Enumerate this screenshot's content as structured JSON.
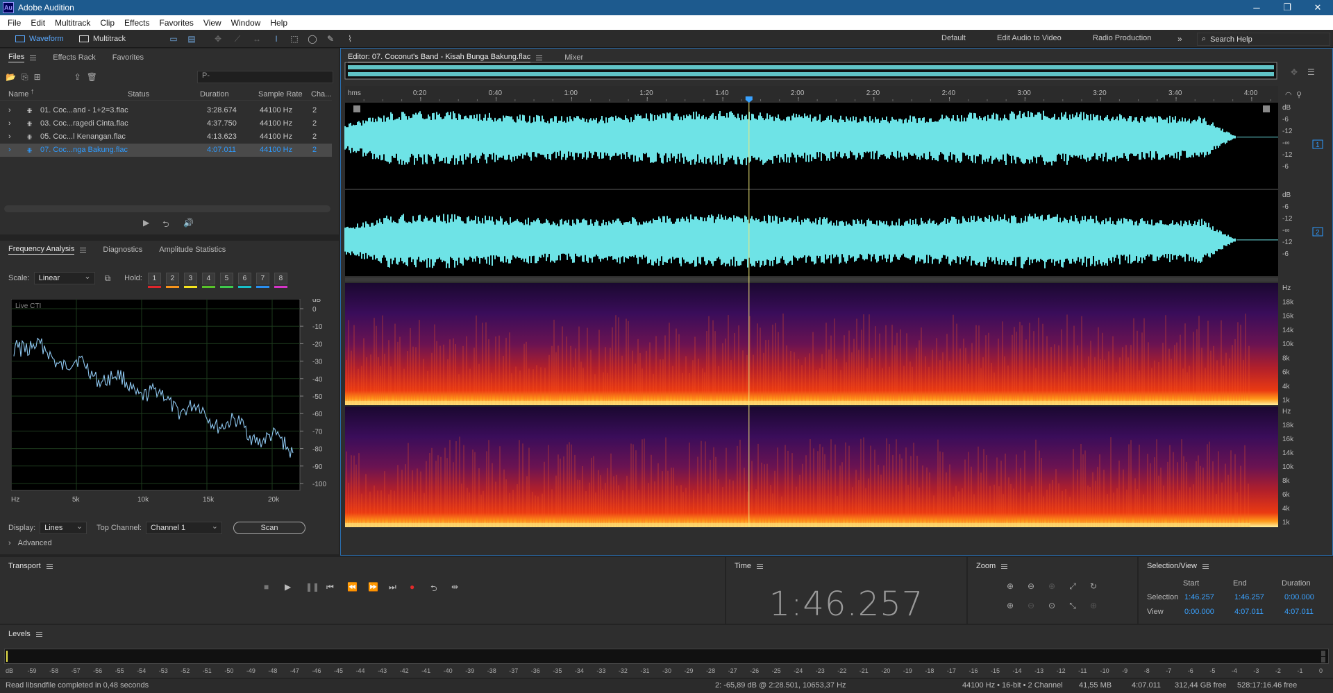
{
  "app": {
    "title": "Adobe Audition",
    "logo": "Au"
  },
  "menu": [
    "File",
    "Edit",
    "Multitrack",
    "Clip",
    "Effects",
    "Favorites",
    "View",
    "Window",
    "Help"
  ],
  "toolbar": {
    "waveform_label": "Waveform",
    "multitrack_label": "Multitrack",
    "workspaces": [
      "Default",
      "Edit Audio to Video",
      "Radio Production"
    ],
    "search_help": "Search Help"
  },
  "files_panel": {
    "tabs": [
      "Files",
      "Effects Rack",
      "Favorites"
    ],
    "columns": [
      "Name",
      "Status",
      "Duration",
      "Sample Rate",
      "Cha..."
    ],
    "rows": [
      {
        "name": "01. Coc...and - 1+2=3.flac",
        "duration": "3:28.674",
        "sample_rate": "44100 Hz",
        "channels": "2"
      },
      {
        "name": "03. Coc...ragedi Cinta.flac",
        "duration": "4:37.750",
        "sample_rate": "44100 Hz",
        "channels": "2"
      },
      {
        "name": "05. Coc...l Kenangan.flac",
        "duration": "4:13.623",
        "sample_rate": "44100 Hz",
        "channels": "2"
      },
      {
        "name": "07. Coc...nga Bakung.flac",
        "duration": "4:07.011",
        "sample_rate": "44100 Hz",
        "channels": "2"
      }
    ],
    "search_placeholder": "P-"
  },
  "analysis_panel": {
    "tabs": [
      "Frequency Analysis",
      "Diagnostics",
      "Amplitude Statistics"
    ],
    "scale_label": "Scale:",
    "scale_value": "Linear",
    "hold_label": "Hold:",
    "hold_buttons": [
      "1",
      "2",
      "3",
      "4",
      "5",
      "6",
      "7",
      "8"
    ],
    "hold_colors": [
      "#e0262c",
      "#f7941d",
      "#f5e41f",
      "#58c32a",
      "#3ec94d",
      "#17c0c9",
      "#2a8ff0",
      "#d534c8"
    ],
    "graph_label": "Live CTI",
    "db_unit": "dB",
    "db_ticks": [
      "0",
      "-10",
      "-20",
      "-30",
      "-40",
      "-50",
      "-60",
      "-70",
      "-80",
      "-90",
      "-100"
    ],
    "freq_ticks": [
      "Hz",
      "5k",
      "10k",
      "15k",
      "20k"
    ],
    "display_label": "Display:",
    "display_value": "Lines",
    "top_channel_label": "Top Channel:",
    "top_channel_value": "Channel 1",
    "scan_label": "Scan",
    "advanced_label": "Advanced"
  },
  "editor": {
    "tab_label": "Editor: 07. Coconut's Band - Kisah Bunga Bakung.flac",
    "mixer_label": "Mixer",
    "time_unit": "hms",
    "time_ticks": [
      "0:20",
      "0:40",
      "1:00",
      "1:20",
      "1:40",
      "2:00",
      "2:20",
      "2:40",
      "3:00",
      "3:20",
      "3:40",
      "4:00"
    ],
    "db_labels": [
      "dB",
      "-6",
      "-12",
      "-∞",
      "-12",
      "-6"
    ],
    "hz_labels": [
      "Hz",
      "18k",
      "16k",
      "14k",
      "10k",
      "8k",
      "6k",
      "4k",
      "1k"
    ],
    "channel_1": "1",
    "channel_2": "2",
    "playhead_fraction": 0.4329
  },
  "transport": {
    "title": "Transport"
  },
  "time_panel": {
    "title": "Time",
    "value": "1:46.257"
  },
  "zoom_panel": {
    "title": "Zoom"
  },
  "selection_view": {
    "title": "Selection/View",
    "headers": [
      "Start",
      "End",
      "Duration"
    ],
    "selection_label": "Selection",
    "selection": [
      "1:46.257",
      "1:46.257",
      "0:00.000"
    ],
    "view_label": "View",
    "view": [
      "0:00.000",
      "4:07.011",
      "4:07.011"
    ]
  },
  "levels": {
    "title": "Levels",
    "scale": [
      "dB",
      "-59",
      "-58",
      "-57",
      "-56",
      "-55",
      "-54",
      "-53",
      "-52",
      "-51",
      "-50",
      "-49",
      "-48",
      "-47",
      "-46",
      "-45",
      "-44",
      "-43",
      "-42",
      "-41",
      "-40",
      "-39",
      "-38",
      "-37",
      "-36",
      "-35",
      "-34",
      "-33",
      "-32",
      "-31",
      "-30",
      "-29",
      "-28",
      "-27",
      "-26",
      "-25",
      "-24",
      "-23",
      "-22",
      "-21",
      "-20",
      "-19",
      "-18",
      "-17",
      "-16",
      "-15",
      "-14",
      "-13",
      "-12",
      "-11",
      "-10",
      "-9",
      "-8",
      "-7",
      "-6",
      "-5",
      "-4",
      "-3",
      "-2",
      "-1",
      "0"
    ]
  },
  "status": {
    "message": "Read libsndfile completed in 0,48 seconds",
    "cursor": "2: -65,89 dB @ 2:28.501, 10653,37 Hz",
    "format": "44100 Hz • 16-bit • 2 Channel",
    "size": "41,55 MB",
    "duration": "4:07.011",
    "free": "312,44 GB free",
    "free_time": "528:17:16.46 free"
  },
  "colors": {
    "accent": "#2e9bff",
    "waveform": "#6ee3e6",
    "playhead": "#f3e97a"
  }
}
